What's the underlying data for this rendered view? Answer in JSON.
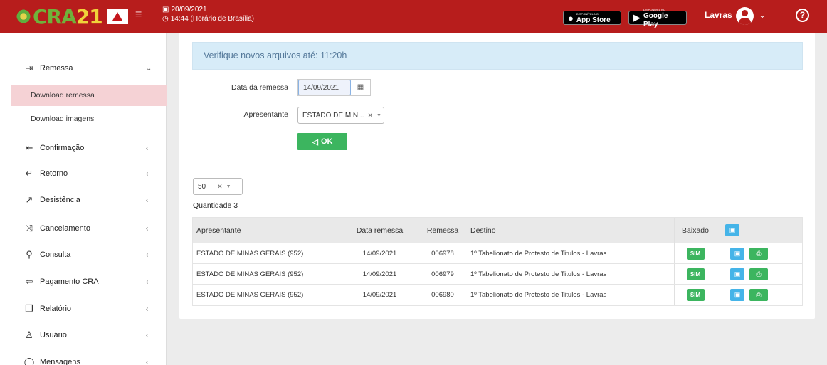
{
  "header": {
    "logo_text_a": "CRA",
    "logo_text_b": "21",
    "date": "20/09/2021",
    "time": "14:44 (Horário de Brasília)",
    "app_store_small": "DISPONÍVEL NO",
    "app_store": "App Store",
    "google_play_small": "DISPONÍVEL NO",
    "google_play": "Google Play",
    "user": "Lavras",
    "help": "?",
    "brand_color": "#b71d1c"
  },
  "sidebar": {
    "items": [
      {
        "label": "Remessa",
        "icon": "enter-icon",
        "glyph": "⇥",
        "chev": "⌄"
      },
      {
        "label": "Confirmação",
        "icon": "confirm-icon",
        "glyph": "⇤",
        "chev": "‹"
      },
      {
        "label": "Retorno",
        "icon": "return-icon",
        "glyph": "↵",
        "chev": "‹"
      },
      {
        "label": "Desistência",
        "icon": "external-icon",
        "glyph": "↗",
        "chev": "‹"
      },
      {
        "label": "Cancelamento",
        "icon": "shuffle-icon",
        "glyph": "⤨",
        "chev": "‹"
      },
      {
        "label": "Consulta",
        "icon": "search-icon",
        "glyph": "⚲",
        "chev": "‹"
      },
      {
        "label": "Pagamento CRA",
        "icon": "back-arrow-icon",
        "glyph": "⇦",
        "chev": "‹"
      },
      {
        "label": "Relatório",
        "icon": "document-icon",
        "glyph": "❐",
        "chev": "‹"
      },
      {
        "label": "Usuário",
        "icon": "users-icon",
        "glyph": "♙",
        "chev": "‹"
      },
      {
        "label": "Mensagens",
        "icon": "chat-icon",
        "glyph": "◯",
        "chev": "‹"
      }
    ],
    "subitems": [
      "Download remessa",
      "Download imagens"
    ]
  },
  "main": {
    "alert": "Verifique novos arquivos até:  11:20h",
    "date_label": "Data da remessa",
    "date_value": "14/09/2021",
    "presenter_label": "Apresentante",
    "presenter_value": "ESTADO DE MIN...",
    "ok_label": "OK",
    "page_size": "50",
    "quantity": "Quantidade 3"
  },
  "table": {
    "headers": {
      "presenter": "Apresentante",
      "date": "Data remessa",
      "remessa": "Remessa",
      "destino": "Destino",
      "baixado": "Baixado"
    },
    "rows": [
      {
        "presenter": "ESTADO DE MINAS GERAIS (952)",
        "date": "14/09/2021",
        "remessa": "006978",
        "destino": "1º Tabelionato de Protesto de Titulos - Lavras",
        "baixado": "SIM"
      },
      {
        "presenter": "ESTADO DE MINAS GERAIS (952)",
        "date": "14/09/2021",
        "remessa": "006979",
        "destino": "1º Tabelionato de Protesto de Titulos - Lavras",
        "baixado": "SIM"
      },
      {
        "presenter": "ESTADO DE MINAS GERAIS (952)",
        "date": "14/09/2021",
        "remessa": "006980",
        "destino": "1º Tabelionato de Protesto de Titulos - Lavras",
        "baixado": "SIM"
      }
    ]
  }
}
